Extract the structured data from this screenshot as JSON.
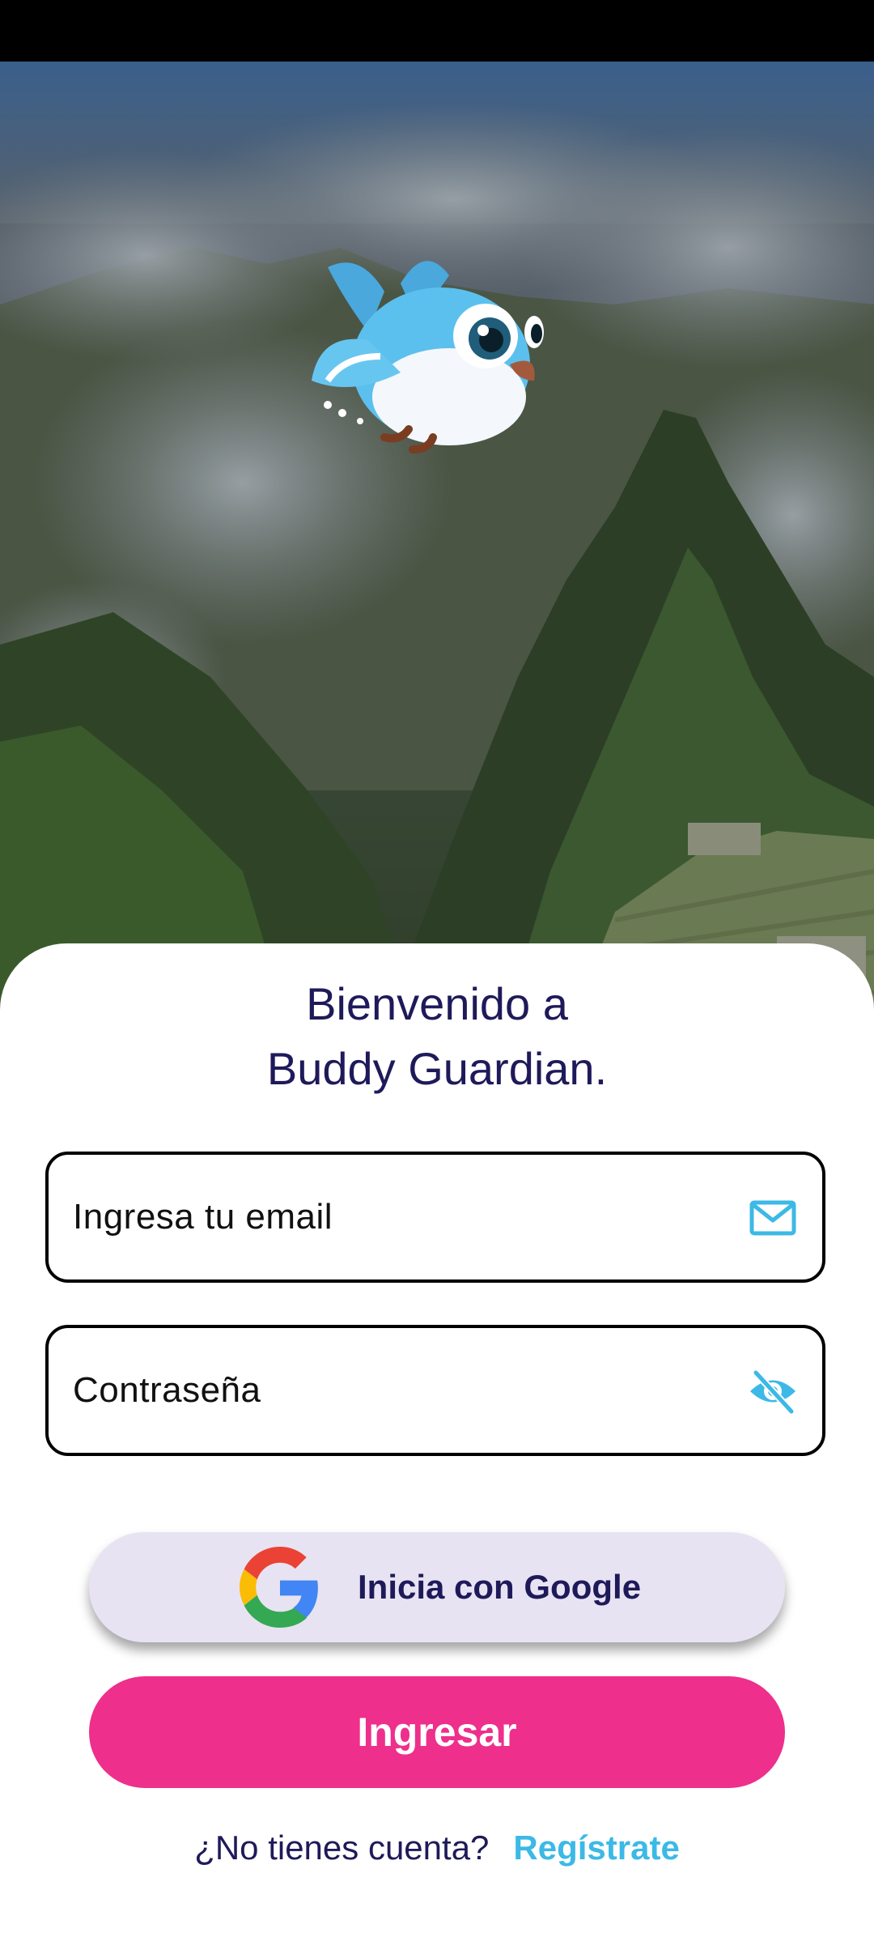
{
  "welcome": {
    "line1": "Bienvenido a",
    "line2": "Buddy Guardian."
  },
  "email": {
    "placeholder": "Ingresa tu email",
    "value": "",
    "icon": "mail-icon"
  },
  "password": {
    "placeholder": "Contraseña",
    "value": "",
    "icon": "eye-off-icon"
  },
  "google_button": {
    "label": "Inicia con Google",
    "icon": "google-logo-icon"
  },
  "submit_button": {
    "label": "Ingresar"
  },
  "footer": {
    "prompt": "¿No tienes cuenta?",
    "register_link": "Regístrate"
  },
  "colors": {
    "primary_text": "#1e1a5a",
    "accent_pink": "#ee2f8b",
    "accent_blue": "#3cb9e6",
    "google_button_bg": "#e8e3f2"
  }
}
